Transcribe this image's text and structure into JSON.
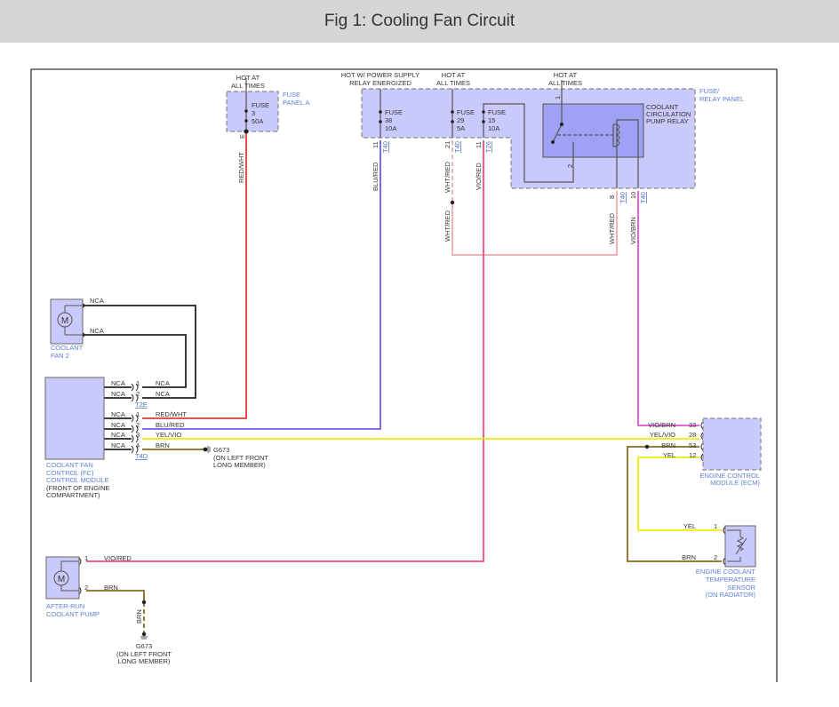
{
  "title": "Fig 1: Cooling Fan Circuit",
  "colors": {
    "red_wht": "#e23b3b",
    "blu_red": "#6b5cf0",
    "vio_red": "#ea4c86",
    "vio_brn": "#e052d6",
    "wht_red": "#f2a8ad",
    "yel": "#f2ee00",
    "brn": "#8a6a20",
    "black": "#222222"
  },
  "sources": {
    "hot_all_times": [
      "HOT AT",
      "ALL TIMES"
    ],
    "hot_relay": [
      "HOT W/ POWER SUPPLY",
      "RELAY ENERGIZED"
    ]
  },
  "fuse_panel_a": {
    "label": [
      "FUSE",
      "PANEL A"
    ],
    "fuse": [
      "FUSE",
      "3",
      "50A"
    ],
    "pin": "E"
  },
  "relay_panel": {
    "label": [
      "FUSE/",
      "RELAY PANEL"
    ],
    "fuse38": [
      "FUSE",
      "38",
      "10A"
    ],
    "fuse29": [
      "FUSE",
      "29",
      "5A"
    ],
    "fuse15": [
      "FUSE",
      "15",
      "10A"
    ],
    "relay": [
      "COOLANT",
      "CIRCULATION",
      "PUMP RELAY"
    ],
    "relay_pins": [
      "1",
      "2"
    ],
    "connectors": [
      {
        "pin": "11",
        "conn": "T40"
      },
      {
        "pin": "21",
        "conn": "T40"
      },
      {
        "pin": "11",
        "conn": "T26"
      },
      {
        "pin": "8",
        "conn": "T40"
      },
      {
        "pin": "10",
        "conn": "T40"
      }
    ]
  },
  "wires": {
    "red_wht": "RED/WHT",
    "blu_red": "BLU/RED",
    "wht_red": "WHT/RED",
    "vio_red": "VIO/RED",
    "vio_brn": "VIO/BRN",
    "yel_vio": "YEL/VIO",
    "brn": "BRN",
    "yel": "YEL",
    "nca": "NCA"
  },
  "coolant_fan2": {
    "label": [
      "COOLANT",
      "FAN 2"
    ],
    "motor": "M"
  },
  "fc_module": {
    "label": [
      "COOLANT FAN",
      "CONTROL (FC)",
      "CONTROL MODULE"
    ],
    "location": [
      "(FRONT OF ENGINE",
      "COMPARTMENT)"
    ],
    "t2e": {
      "name": "T2E",
      "pins": [
        {
          "pin": "1",
          "left": "NCA",
          "right": "NCA"
        },
        {
          "pin": "2",
          "left": "NCA",
          "right": "NCA"
        }
      ]
    },
    "t4d": {
      "name": "T4D",
      "pins": [
        {
          "pin": "1",
          "left": "NCA",
          "right": "RED/WHT"
        },
        {
          "pin": "2",
          "left": "NCA",
          "right": "BLU/RED"
        },
        {
          "pin": "3",
          "left": "NCA",
          "right": "YEL/VIO"
        },
        {
          "pin": "4",
          "left": "NCA",
          "right": "BRN"
        }
      ]
    }
  },
  "ground": {
    "name": "G673",
    "location": [
      "(ON LEFT FRONT",
      "LONG MEMBER)"
    ]
  },
  "ecm": {
    "label": [
      "ENGINE CONTROL",
      "MODULE (ECM)"
    ],
    "pins": [
      {
        "pin": "33",
        "wire": "VIO/BRN"
      },
      {
        "pin": "28",
        "wire": "YEL/VIO"
      },
      {
        "pin": "53",
        "wire": "BRN"
      },
      {
        "pin": "12",
        "wire": "YEL"
      }
    ]
  },
  "ect_sensor": {
    "label": [
      "ENGINE COOLANT",
      "TEMPERATURE",
      "SENSOR"
    ],
    "location": "(ON RADIATOR)",
    "pins": [
      {
        "pin": "1",
        "wire": "YEL"
      },
      {
        "pin": "2",
        "wire": "BRN"
      }
    ]
  },
  "pump": {
    "label": [
      "AFTER-RUN",
      "COOLANT PUMP"
    ],
    "motor": "M",
    "pins": [
      {
        "pin": "1",
        "wire": "VIO/RED"
      },
      {
        "pin": "2",
        "wire": "BRN"
      }
    ]
  }
}
